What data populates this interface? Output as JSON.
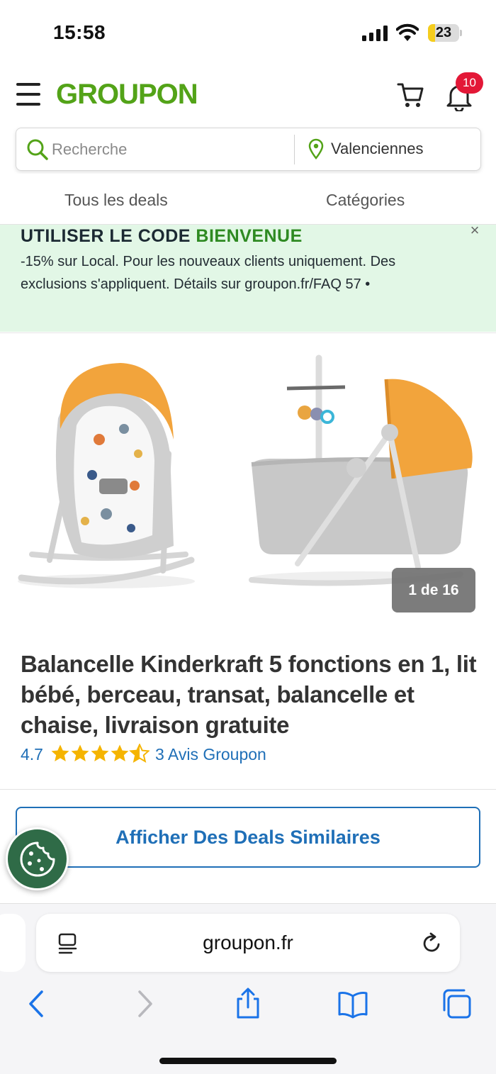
{
  "status_bar": {
    "time": "15:58",
    "battery_level": "23",
    "battery_fraction": 0.23
  },
  "header": {
    "logo": "GROUPON",
    "notification_count": "10"
  },
  "search": {
    "placeholder": "Recherche",
    "location": "Valenciennes"
  },
  "nav_tabs": [
    {
      "label": "Tous les deals"
    },
    {
      "label": "Catégories"
    }
  ],
  "promo": {
    "title_prefix": "UTILISER LE CODE",
    "code": "BIENVENUE",
    "body": "-15% sur Local. Pour les nouveaux clients uniquement. Des exclusions s'appliquent. Détails sur groupon.fr/FAQ 57 •",
    "close": "×"
  },
  "product": {
    "image_counter": "1 de 16",
    "title": "Balancelle Kinderkraft 5 fonctions en 1, lit bébé, berceau, transat, balancelle et chaise, livraison gratuite",
    "rating": "4.7",
    "rating_stars": 4.5,
    "reviews": "3 Avis Groupon"
  },
  "similar_button": "Afficher Des Deals Similaires",
  "browser": {
    "url": "groupon.fr"
  },
  "colors": {
    "brand_green": "#53a318",
    "link_blue": "#1f6fb7",
    "promo_bg": "#e2f7e6",
    "badge_red": "#e31837",
    "star_yellow": "#f5b400",
    "cookie_green": "#2f6b47",
    "product_orange": "#f2a43c"
  },
  "icons": [
    "signal-icon",
    "wifi-icon",
    "battery-icon",
    "menu-icon",
    "cart-icon",
    "bell-icon",
    "search-icon",
    "location-pin-icon",
    "close-icon",
    "star-icon",
    "cookie-icon",
    "reader-icon",
    "reload-icon",
    "back-icon",
    "forward-icon",
    "share-icon",
    "bookmarks-icon",
    "tabs-icon"
  ]
}
